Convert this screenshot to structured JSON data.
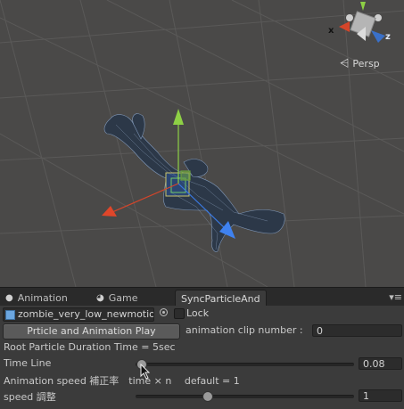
{
  "scene": {
    "projection_label": "Persp",
    "gizmo_axis_x": "x",
    "gizmo_axis_z": "z"
  },
  "tabs": [
    {
      "label": "Animation",
      "icon": "animation-icon"
    },
    {
      "label": "Game",
      "icon": "game-controller-icon"
    },
    {
      "label": "SyncParticleAnd",
      "active": true
    }
  ],
  "inspector": {
    "object_field": "zombie_very_low_newmotion",
    "lock_label": "Lock",
    "play_button": "Prticle and Animation Play",
    "clip_number_label": "animation clip number :",
    "clip_number_value": "0",
    "duration_label": "Root Particle Duration Time = 5sec",
    "timeline_label": "Time Line",
    "timeline_value": "0.08",
    "timeline_fraction": 0.03,
    "anim_speed_label": "Animation speed 補正率　time × n　 default = 1",
    "speed_label": "speed 調整",
    "speed_value": "1",
    "speed_fraction": 0.33
  }
}
